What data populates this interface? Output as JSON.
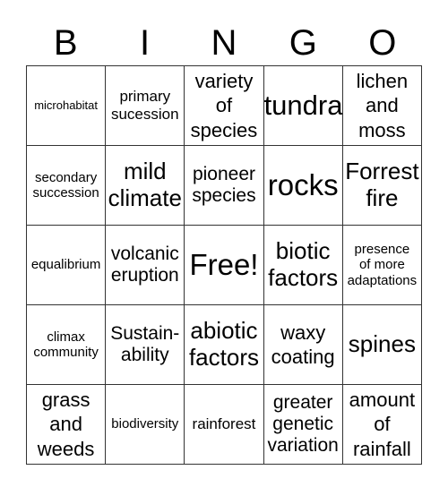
{
  "header": {
    "letters": [
      "B",
      "I",
      "N",
      "G",
      "O"
    ]
  },
  "grid": {
    "rows": [
      [
        "microhabitat",
        "primary\nsucession",
        "variety\nof\nspecies",
        "tundra",
        "lichen\nand\nmoss"
      ],
      [
        "secondary\nsuccession",
        "mild\nclimate",
        "pioneer\nspecies",
        "rocks",
        "Forrest\nfire"
      ],
      [
        "equalibrium",
        "volcanic\neruption",
        "Free!",
        "biotic\nfactors",
        "presence\nof more\nadaptations"
      ],
      [
        "climax\ncommunity",
        "Sustain-\nability",
        "abiotic\nfactors",
        "waxy\ncoating",
        "spines"
      ],
      [
        "grass\nand\nweeds",
        "biodiversity",
        "rainforest",
        "greater\ngenetic\nvariation",
        "amount\nof\nrainfall"
      ]
    ]
  }
}
